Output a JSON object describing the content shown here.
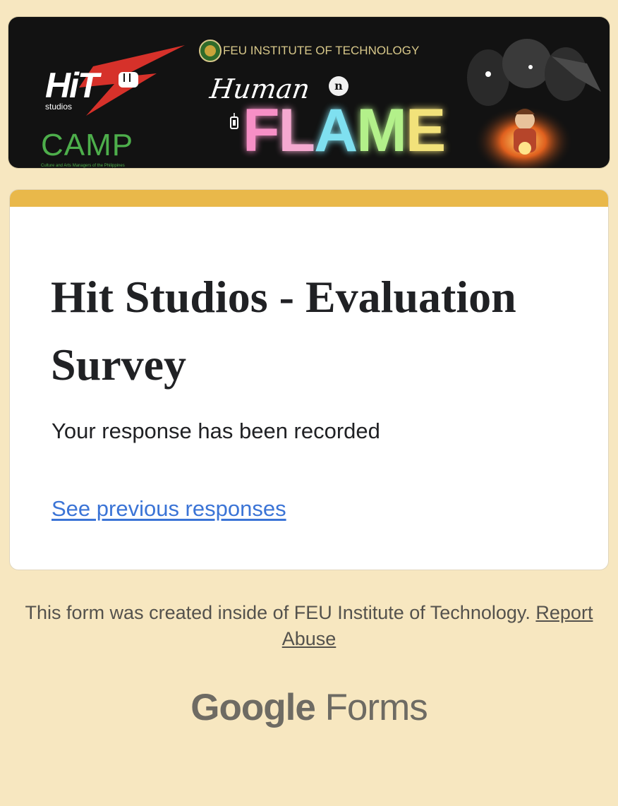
{
  "banner": {
    "hit_logo": "HiT",
    "hit_sub": "studios",
    "camp_logo": "CAMP",
    "camp_sub": "Culture and Arts Managers of the Philippines",
    "institution": "FEU INSTITUTE OF TECHNOLOGY",
    "event_script": "Human",
    "event_n": "n",
    "event_title_letters": [
      "F",
      "L",
      "A",
      "M",
      "E"
    ],
    "event_title_colors": [
      "#f78fc6",
      "#f5a9d0",
      "#7fe0f0",
      "#b3f08a",
      "#f2e27a"
    ]
  },
  "card": {
    "accent_color": "#e9b84a",
    "title": "Hit Studios - Evaluation Survey",
    "confirmation": "Your response has been recorded",
    "previous_link": "See previous responses"
  },
  "footer": {
    "note": "This form was created inside of FEU Institute of Technology.",
    "report_link": "Report Abuse",
    "brand_google": "Google",
    "brand_forms": "Forms"
  }
}
